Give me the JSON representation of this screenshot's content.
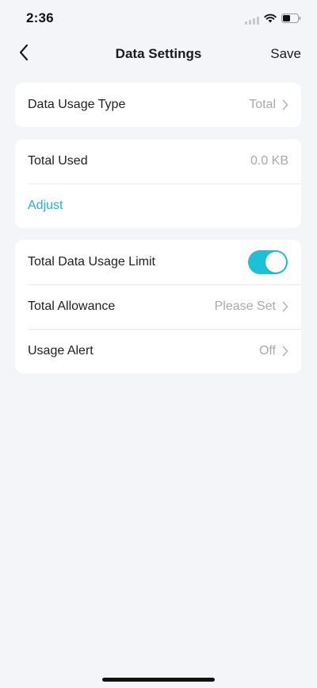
{
  "status_bar": {
    "time": "2:36"
  },
  "nav": {
    "title": "Data Settings",
    "save_label": "Save"
  },
  "usage_type": {
    "label": "Data Usage Type",
    "value": "Total"
  },
  "usage": {
    "total_used_label": "Total Used",
    "total_used_value": "0.0 KB",
    "adjust_label": "Adjust"
  },
  "limit": {
    "limit_label": "Total Data Usage Limit",
    "limit_enabled": true,
    "allowance_label": "Total Allowance",
    "allowance_value": "Please Set",
    "alert_label": "Usage Alert",
    "alert_value": "Off"
  },
  "colors": {
    "accent": "#1dc1d6",
    "link": "#1fb4c8",
    "background": "#f4f5f9"
  }
}
